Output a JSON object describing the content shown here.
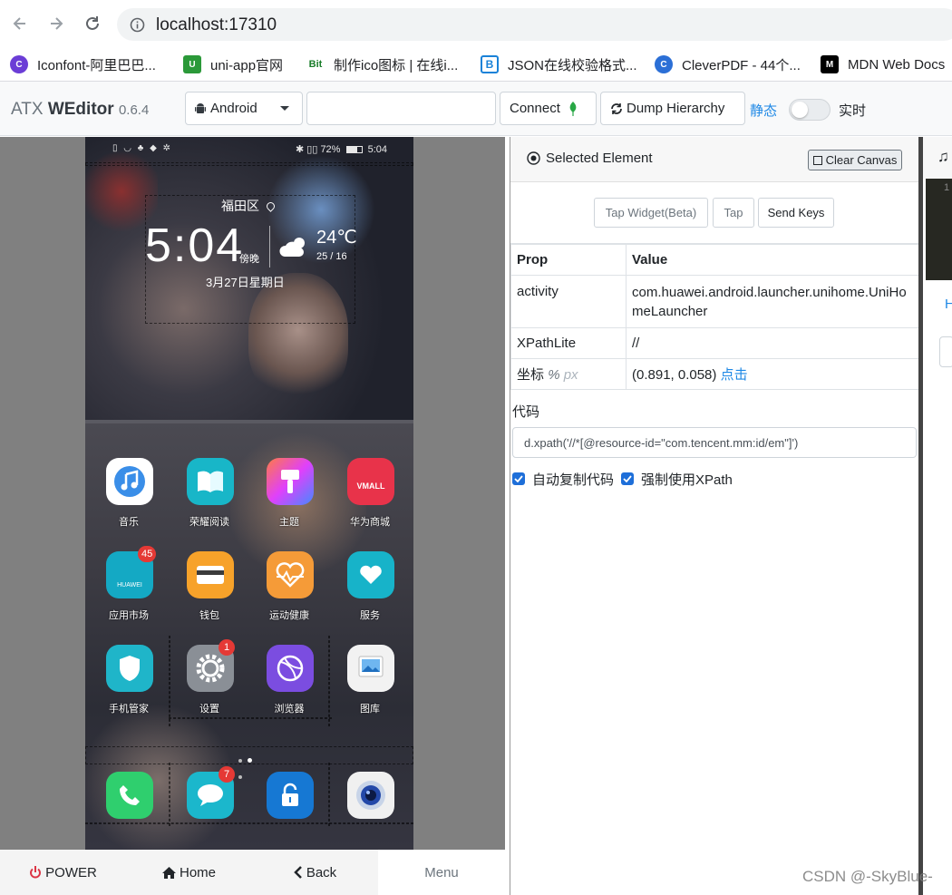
{
  "browser": {
    "url": "localhost:17310",
    "bookmarks": [
      {
        "label": "Iconfont-阿里巴巴...",
        "icon": "iconfont-logo-icon",
        "color": "#6b3dd6"
      },
      {
        "label": "uni-app官网",
        "icon": "uniapp-logo-icon",
        "color": "#2b9939"
      },
      {
        "label": "制作ico图标 | 在线i...",
        "icon": "bitbug-logo-icon",
        "color": "#1a7d2a"
      },
      {
        "label": "JSON在线校验格式...",
        "icon": "bejson-logo-icon",
        "color": "#1a82d8"
      },
      {
        "label": "CleverPDF - 44个...",
        "icon": "cleverpdf-logo-icon",
        "color": "#2b6fd6"
      },
      {
        "label": "MDN Web Docs",
        "icon": "mdn-logo-icon",
        "color": "#000000"
      }
    ]
  },
  "app": {
    "brand": "ATX",
    "brand_bold": "WEditor",
    "version": "0.6.4",
    "platform": "Android",
    "device_input": "",
    "connect_label": "Connect",
    "dump_label": "Dump Hierarchy",
    "static_label": "静态",
    "live_label": "实时"
  },
  "phone": {
    "status_time": "5:04",
    "battery": "72%",
    "district": "福田区",
    "clock": "5:04",
    "clock_sub": "傍晚",
    "temp": "24℃",
    "temp_range": "25 / 16",
    "date": "3月27日星期日",
    "apps": [
      {
        "label": "音乐",
        "icon": "music-icon",
        "badge": ""
      },
      {
        "label": "荣耀阅读",
        "icon": "book-icon",
        "badge": ""
      },
      {
        "label": "主题",
        "icon": "brush-icon",
        "badge": ""
      },
      {
        "label": "华为商城",
        "icon": "vmall-icon",
        "badge": ""
      },
      {
        "label": "应用市场",
        "icon": "huawei-appgallery-icon",
        "badge": "45"
      },
      {
        "label": "钱包",
        "icon": "wallet-icon",
        "badge": ""
      },
      {
        "label": "运动健康",
        "icon": "health-heart-icon",
        "badge": ""
      },
      {
        "label": "服务",
        "icon": "service-heart-icon",
        "badge": ""
      },
      {
        "label": "手机管家",
        "icon": "shield-icon",
        "badge": ""
      },
      {
        "label": "设置",
        "icon": "gear-icon",
        "badge": "1"
      },
      {
        "label": "浏览器",
        "icon": "browser-globe-icon",
        "badge": ""
      },
      {
        "label": "图库",
        "icon": "gallery-icon",
        "badge": ""
      }
    ],
    "dock": [
      {
        "icon": "phone-icon",
        "badge": ""
      },
      {
        "icon": "message-icon",
        "badge": "7"
      },
      {
        "icon": "lock-icon",
        "badge": ""
      },
      {
        "icon": "camera-icon",
        "badge": ""
      }
    ],
    "vmall_text": "VMALL",
    "huawei_text": "HUAWEI"
  },
  "controls": {
    "power": "POWER",
    "home": "Home",
    "back": "Back",
    "menu": "Menu"
  },
  "inspector": {
    "title": "Selected Element",
    "clear_canvas": "Clear Canvas",
    "tap_widget": "Tap Widget(Beta)",
    "tap": "Tap",
    "send_keys": "Send Keys",
    "col_prop": "Prop",
    "col_value": "Value",
    "rows": [
      {
        "prop": "activity",
        "value": "com.huawei.android.launcher.unihome.UniHomeLauncher"
      },
      {
        "prop": "XPathLite",
        "value": "//"
      }
    ],
    "coord_prop": "坐标",
    "coord_unit_pct": "%",
    "coord_unit_px": "px",
    "coord_value": "(0.891, 0.058)",
    "coord_link": "点击",
    "code_label": "代码",
    "code": "d.xpath('//*[@resource-id=\"com.tencent.mm:id/em\"]')",
    "auto_copy": "自动复制代码",
    "force_xpath": "强制使用XPath"
  },
  "right": {
    "letter": "H"
  },
  "watermark": "CSDN @-SkyBlue-"
}
